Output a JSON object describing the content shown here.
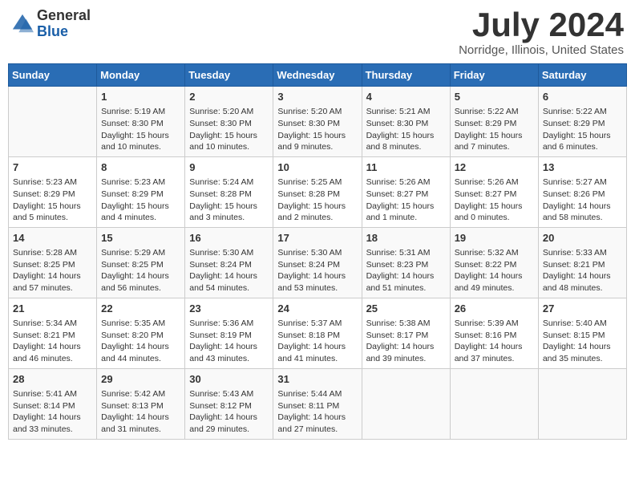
{
  "logo": {
    "general": "General",
    "blue": "Blue"
  },
  "title": "July 2024",
  "location": "Norridge, Illinois, United States",
  "days_of_week": [
    "Sunday",
    "Monday",
    "Tuesday",
    "Wednesday",
    "Thursday",
    "Friday",
    "Saturday"
  ],
  "weeks": [
    [
      {
        "day": "",
        "empty": true
      },
      {
        "day": "1",
        "sunrise": "Sunrise: 5:19 AM",
        "sunset": "Sunset: 8:30 PM",
        "daylight": "Daylight: 15 hours and 10 minutes."
      },
      {
        "day": "2",
        "sunrise": "Sunrise: 5:20 AM",
        "sunset": "Sunset: 8:30 PM",
        "daylight": "Daylight: 15 hours and 10 minutes."
      },
      {
        "day": "3",
        "sunrise": "Sunrise: 5:20 AM",
        "sunset": "Sunset: 8:30 PM",
        "daylight": "Daylight: 15 hours and 9 minutes."
      },
      {
        "day": "4",
        "sunrise": "Sunrise: 5:21 AM",
        "sunset": "Sunset: 8:30 PM",
        "daylight": "Daylight: 15 hours and 8 minutes."
      },
      {
        "day": "5",
        "sunrise": "Sunrise: 5:22 AM",
        "sunset": "Sunset: 8:29 PM",
        "daylight": "Daylight: 15 hours and 7 minutes."
      },
      {
        "day": "6",
        "sunrise": "Sunrise: 5:22 AM",
        "sunset": "Sunset: 8:29 PM",
        "daylight": "Daylight: 15 hours and 6 minutes."
      }
    ],
    [
      {
        "day": "7",
        "sunrise": "Sunrise: 5:23 AM",
        "sunset": "Sunset: 8:29 PM",
        "daylight": "Daylight: 15 hours and 5 minutes."
      },
      {
        "day": "8",
        "sunrise": "Sunrise: 5:23 AM",
        "sunset": "Sunset: 8:29 PM",
        "daylight": "Daylight: 15 hours and 4 minutes."
      },
      {
        "day": "9",
        "sunrise": "Sunrise: 5:24 AM",
        "sunset": "Sunset: 8:28 PM",
        "daylight": "Daylight: 15 hours and 3 minutes."
      },
      {
        "day": "10",
        "sunrise": "Sunrise: 5:25 AM",
        "sunset": "Sunset: 8:28 PM",
        "daylight": "Daylight: 15 hours and 2 minutes."
      },
      {
        "day": "11",
        "sunrise": "Sunrise: 5:26 AM",
        "sunset": "Sunset: 8:27 PM",
        "daylight": "Daylight: 15 hours and 1 minute."
      },
      {
        "day": "12",
        "sunrise": "Sunrise: 5:26 AM",
        "sunset": "Sunset: 8:27 PM",
        "daylight": "Daylight: 15 hours and 0 minutes."
      },
      {
        "day": "13",
        "sunrise": "Sunrise: 5:27 AM",
        "sunset": "Sunset: 8:26 PM",
        "daylight": "Daylight: 14 hours and 58 minutes."
      }
    ],
    [
      {
        "day": "14",
        "sunrise": "Sunrise: 5:28 AM",
        "sunset": "Sunset: 8:25 PM",
        "daylight": "Daylight: 14 hours and 57 minutes."
      },
      {
        "day": "15",
        "sunrise": "Sunrise: 5:29 AM",
        "sunset": "Sunset: 8:25 PM",
        "daylight": "Daylight: 14 hours and 56 minutes."
      },
      {
        "day": "16",
        "sunrise": "Sunrise: 5:30 AM",
        "sunset": "Sunset: 8:24 PM",
        "daylight": "Daylight: 14 hours and 54 minutes."
      },
      {
        "day": "17",
        "sunrise": "Sunrise: 5:30 AM",
        "sunset": "Sunset: 8:24 PM",
        "daylight": "Daylight: 14 hours and 53 minutes."
      },
      {
        "day": "18",
        "sunrise": "Sunrise: 5:31 AM",
        "sunset": "Sunset: 8:23 PM",
        "daylight": "Daylight: 14 hours and 51 minutes."
      },
      {
        "day": "19",
        "sunrise": "Sunrise: 5:32 AM",
        "sunset": "Sunset: 8:22 PM",
        "daylight": "Daylight: 14 hours and 49 minutes."
      },
      {
        "day": "20",
        "sunrise": "Sunrise: 5:33 AM",
        "sunset": "Sunset: 8:21 PM",
        "daylight": "Daylight: 14 hours and 48 minutes."
      }
    ],
    [
      {
        "day": "21",
        "sunrise": "Sunrise: 5:34 AM",
        "sunset": "Sunset: 8:21 PM",
        "daylight": "Daylight: 14 hours and 46 minutes."
      },
      {
        "day": "22",
        "sunrise": "Sunrise: 5:35 AM",
        "sunset": "Sunset: 8:20 PM",
        "daylight": "Daylight: 14 hours and 44 minutes."
      },
      {
        "day": "23",
        "sunrise": "Sunrise: 5:36 AM",
        "sunset": "Sunset: 8:19 PM",
        "daylight": "Daylight: 14 hours and 43 minutes."
      },
      {
        "day": "24",
        "sunrise": "Sunrise: 5:37 AM",
        "sunset": "Sunset: 8:18 PM",
        "daylight": "Daylight: 14 hours and 41 minutes."
      },
      {
        "day": "25",
        "sunrise": "Sunrise: 5:38 AM",
        "sunset": "Sunset: 8:17 PM",
        "daylight": "Daylight: 14 hours and 39 minutes."
      },
      {
        "day": "26",
        "sunrise": "Sunrise: 5:39 AM",
        "sunset": "Sunset: 8:16 PM",
        "daylight": "Daylight: 14 hours and 37 minutes."
      },
      {
        "day": "27",
        "sunrise": "Sunrise: 5:40 AM",
        "sunset": "Sunset: 8:15 PM",
        "daylight": "Daylight: 14 hours and 35 minutes."
      }
    ],
    [
      {
        "day": "28",
        "sunrise": "Sunrise: 5:41 AM",
        "sunset": "Sunset: 8:14 PM",
        "daylight": "Daylight: 14 hours and 33 minutes."
      },
      {
        "day": "29",
        "sunrise": "Sunrise: 5:42 AM",
        "sunset": "Sunset: 8:13 PM",
        "daylight": "Daylight: 14 hours and 31 minutes."
      },
      {
        "day": "30",
        "sunrise": "Sunrise: 5:43 AM",
        "sunset": "Sunset: 8:12 PM",
        "daylight": "Daylight: 14 hours and 29 minutes."
      },
      {
        "day": "31",
        "sunrise": "Sunrise: 5:44 AM",
        "sunset": "Sunset: 8:11 PM",
        "daylight": "Daylight: 14 hours and 27 minutes."
      },
      {
        "day": "",
        "empty": true
      },
      {
        "day": "",
        "empty": true
      },
      {
        "day": "",
        "empty": true
      }
    ]
  ]
}
